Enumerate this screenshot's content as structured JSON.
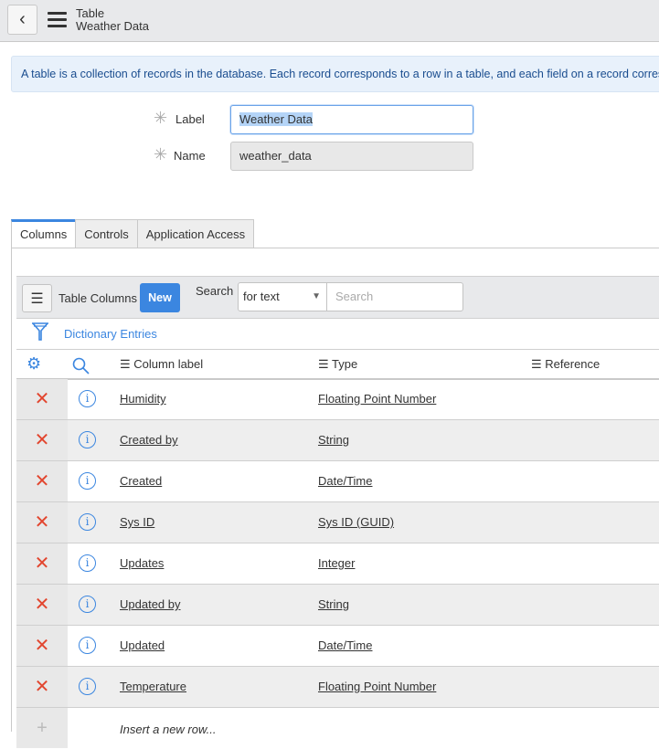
{
  "header": {
    "title": "Table",
    "subtitle": "Weather Data"
  },
  "info": "A table is a collection of records in the database. Each record corresponds to a row in a table, and each field on a record corresponds to a column on the table.",
  "form": {
    "label_label": "Label",
    "label_value": "Weather Data",
    "name_label": "Name",
    "name_value": "weather_data"
  },
  "tabs": [
    "Columns",
    "Controls",
    "Application Access"
  ],
  "list": {
    "title": "Table Columns",
    "new": "New",
    "search_label": "Search",
    "search_select": "for text",
    "search_placeholder": "Search",
    "breadcrumb": "Dictionary Entries",
    "headers": [
      "Column label",
      "Type",
      "Reference"
    ],
    "rows": [
      {
        "label": "Humidity",
        "type": "Floating Point Number"
      },
      {
        "label": "Created by",
        "type": "String"
      },
      {
        "label": "Created",
        "type": "Date/Time"
      },
      {
        "label": "Sys ID",
        "type": "Sys ID (GUID)"
      },
      {
        "label": "Updates",
        "type": "Integer"
      },
      {
        "label": "Updated by",
        "type": "String"
      },
      {
        "label": "Updated",
        "type": "Date/Time"
      },
      {
        "label": "Temperature",
        "type": "Floating Point Number"
      }
    ],
    "insert": "Insert a new row..."
  }
}
